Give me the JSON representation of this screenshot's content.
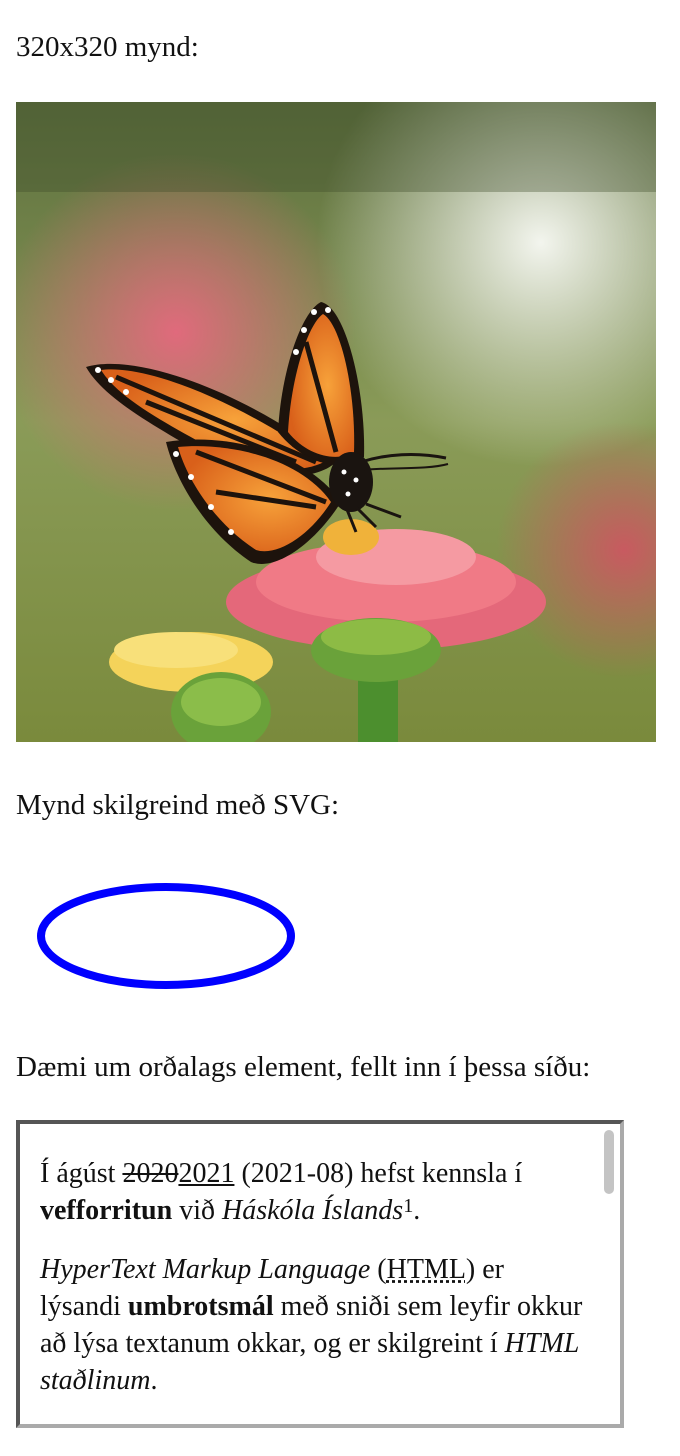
{
  "captions": {
    "image": "320x320 mynd:",
    "svg": "Mynd skilgreind með SVG:",
    "inline": "Dæmi um orðalags element, fellt inn í þessa síðu:"
  },
  "photo": {
    "subject": "monarch butterfly on pink zinnia flower",
    "colors": {
      "wing_orange": "#ee7a1e",
      "flower_pink": "#f07a86",
      "flower_yellow": "#f4d35a",
      "stem_green": "#4c8f2e"
    }
  },
  "svg_demo": {
    "shape": "ellipse",
    "stroke_color": "#0000ff",
    "fill": "none"
  },
  "embedded": {
    "p1": {
      "t1": "Í ágúst ",
      "deleted": "2020",
      "inserted": "2021",
      "t2": " (2021-08) hefst kennsla í ",
      "strong": "vefforritun",
      "t3": " við ",
      "em": "Háskóla Íslands",
      "sup": "1",
      "t4": "."
    },
    "p2": {
      "em1": "HyperText Markup Language",
      "t1": " (",
      "abbr": "HTML",
      "t2": ") er lýsandi ",
      "strong": "umbrotsmál",
      "t3": " með sniði sem leyfir okkur að lýsa textanum okkar, og er skilgreint í ",
      "em2": "HTML staðlinum",
      "t4": "."
    }
  }
}
